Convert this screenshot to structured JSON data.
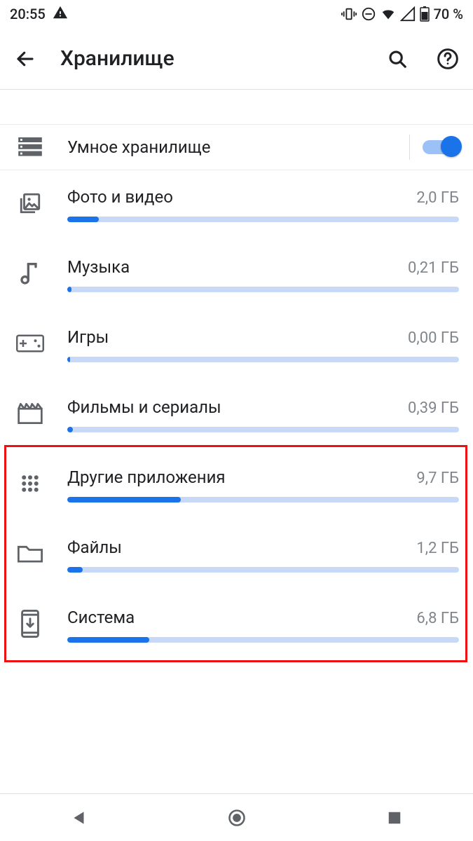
{
  "status": {
    "time": "20:55",
    "battery": "70 %"
  },
  "appbar": {
    "title": "Хранилище"
  },
  "smart": {
    "label": "Умное хранилище",
    "on": true
  },
  "categories": [
    {
      "id": "photos",
      "label": "Фото и видео",
      "size": "2,0 ГБ",
      "pct": 8
    },
    {
      "id": "music",
      "label": "Музыка",
      "size": "0,21 ГБ",
      "pct": 1
    },
    {
      "id": "games",
      "label": "Игры",
      "size": "0,00 ГБ",
      "pct": 0
    },
    {
      "id": "movies",
      "label": "Фильмы и сериалы",
      "size": "0,39 ГБ",
      "pct": 1.5
    },
    {
      "id": "apps",
      "label": "Другие приложения",
      "size": "9,7 ГБ",
      "pct": 29
    },
    {
      "id": "files",
      "label": "Файлы",
      "size": "1,2 ГБ",
      "pct": 4
    },
    {
      "id": "system",
      "label": "Система",
      "size": "6,8 ГБ",
      "pct": 21
    }
  ],
  "highlight": {
    "start": 4,
    "end": 6
  }
}
